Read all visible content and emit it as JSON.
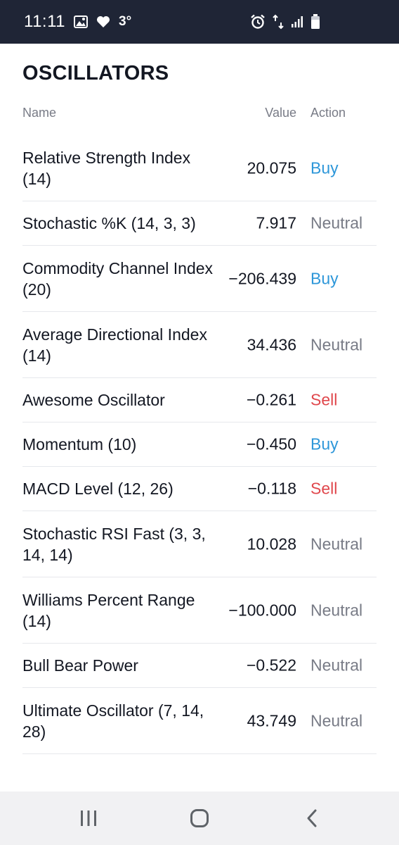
{
  "status_bar": {
    "time": "11:11",
    "temperature": "3°",
    "icons": [
      "image-icon",
      "heart-icon",
      "alarm-icon",
      "data-transfer-icon",
      "signal-icon",
      "battery-icon"
    ]
  },
  "section": {
    "title": "OSCILLATORS",
    "columns": {
      "name": "Name",
      "value": "Value",
      "action": "Action"
    }
  },
  "rows": [
    {
      "name": "Relative Strength Index (14)",
      "value": "20.075",
      "action": "Buy"
    },
    {
      "name": "Stochastic %K (14, 3, 3)",
      "value": "7.917",
      "action": "Neutral"
    },
    {
      "name": "Commodity Channel Index (20)",
      "value": "−206.439",
      "action": "Buy"
    },
    {
      "name": "Average Directional Index (14)",
      "value": "34.436",
      "action": "Neutral"
    },
    {
      "name": "Awesome Oscillator",
      "value": "−0.261",
      "action": "Sell"
    },
    {
      "name": "Momentum (10)",
      "value": "−0.450",
      "action": "Buy"
    },
    {
      "name": "MACD Level (12, 26)",
      "value": "−0.118",
      "action": "Sell"
    },
    {
      "name": "Stochastic RSI Fast (3, 3, 14, 14)",
      "value": "10.028",
      "action": "Neutral"
    },
    {
      "name": "Williams Percent Range (14)",
      "value": "−100.000",
      "action": "Neutral"
    },
    {
      "name": "Bull Bear Power",
      "value": "−0.522",
      "action": "Neutral"
    },
    {
      "name": "Ultimate Oscillator (7, 14, 28)",
      "value": "43.749",
      "action": "Neutral"
    }
  ],
  "colors": {
    "buy": "#2e97d9",
    "sell": "#e0474c",
    "neutral": "#787b86",
    "status_bar_bg": "#1f2536"
  },
  "nav_bar": {
    "buttons": [
      "recent-apps-icon",
      "home-icon",
      "back-icon"
    ]
  }
}
